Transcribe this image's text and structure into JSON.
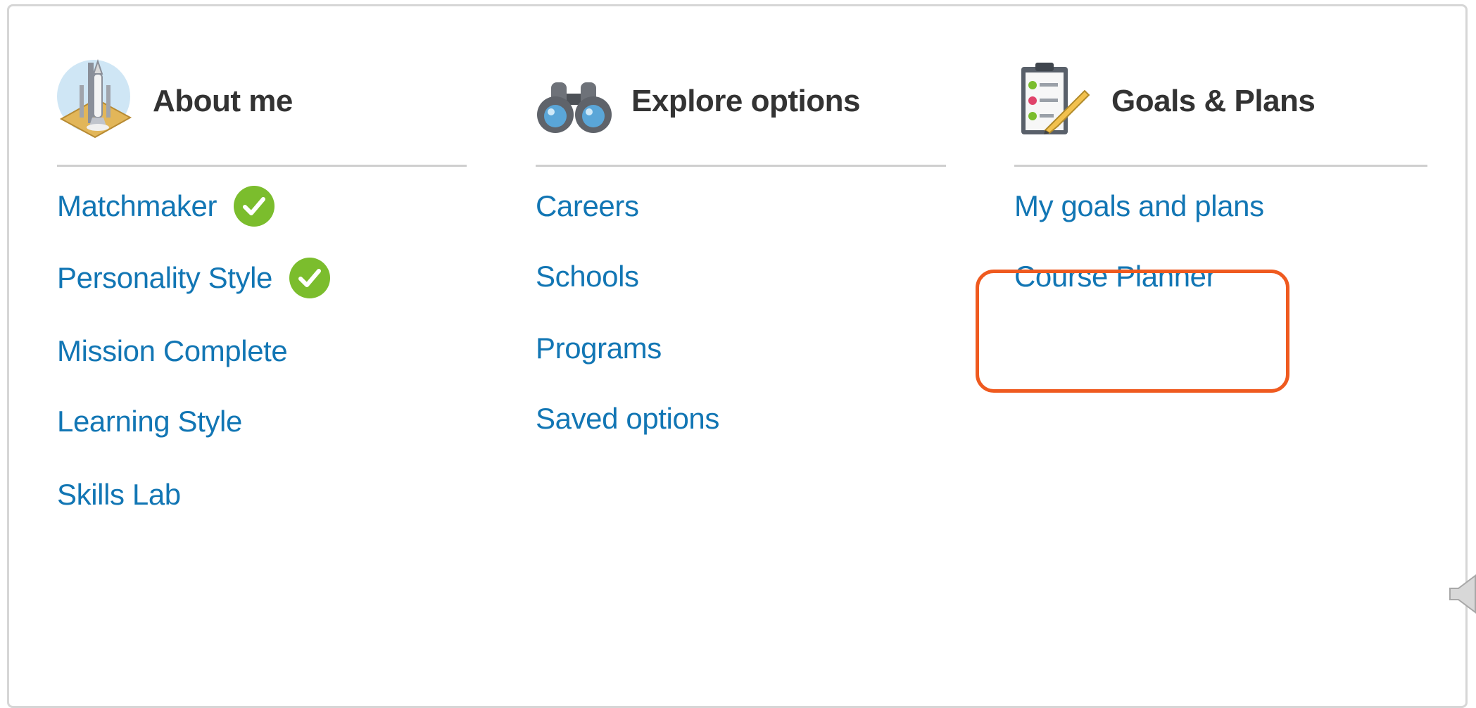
{
  "columns": [
    {
      "title": "About me",
      "icon": "rocket-launch-icon",
      "links": [
        {
          "label": "Matchmaker",
          "completed": true
        },
        {
          "label": "Personality Style",
          "completed": true
        },
        {
          "label": "Mission Complete",
          "completed": false
        },
        {
          "label": "Learning Style",
          "completed": false
        },
        {
          "label": "Skills Lab",
          "completed": false
        }
      ]
    },
    {
      "title": "Explore options",
      "icon": "binoculars-icon",
      "links": [
        {
          "label": "Careers"
        },
        {
          "label": "Schools"
        },
        {
          "label": "Programs"
        },
        {
          "label": "Saved options"
        }
      ]
    },
    {
      "title": "Goals & Plans",
      "icon": "clipboard-checklist-icon",
      "links": [
        {
          "label": "My goals and plans"
        },
        {
          "label": "Course Planner",
          "highlighted": true
        }
      ]
    }
  ],
  "colors": {
    "link": "#1276b4",
    "heading": "#333333",
    "check": "#7bbd2d",
    "highlight": "#ef5a1f",
    "divider": "#cfcfcf"
  }
}
